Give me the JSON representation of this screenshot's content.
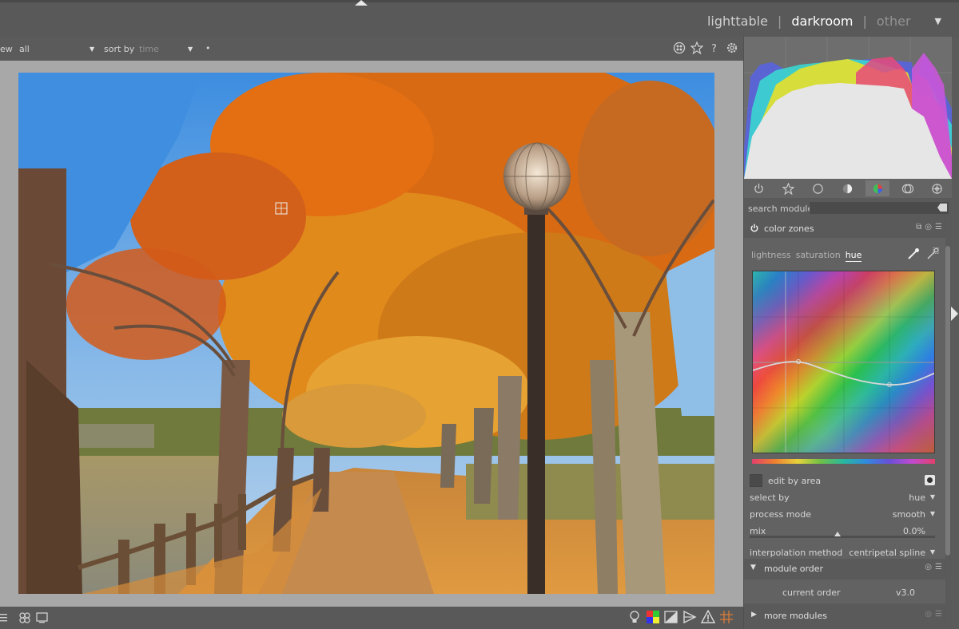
{
  "views": {
    "lighttable": "lighttable",
    "sep": "|",
    "darkroom": "darkroom",
    "other": "other"
  },
  "filterbar": {
    "view_label": "ew",
    "view_value": "all",
    "sort_label": "sort by",
    "sort_value": "time",
    "order_glyph": "•"
  },
  "filterbar_icons": [
    "grouping-icon",
    "star-icon",
    "help-icon",
    "gear-icon"
  ],
  "panel": {
    "search_label": "search module",
    "search_value": "",
    "tabs": [
      "power-icon",
      "favorites-icon",
      "base-icon",
      "tone-icon",
      "color-icon",
      "correct-icon",
      "effect-icon"
    ],
    "selected_tab": "color-icon"
  },
  "color_zones": {
    "title": "color zones",
    "tabs": [
      "lightness",
      "saturation",
      "hue"
    ],
    "active_tab": "hue",
    "edit_by_area_label": "edit by area",
    "select_by_label": "select by",
    "select_by_value": "hue",
    "process_mode_label": "process mode",
    "process_mode_value": "smooth",
    "mix_label": "mix",
    "mix_value": "0.0%",
    "mix_fraction": 0.0,
    "interpolation_label": "interpolation method",
    "interpolation_value": "centripetal spline"
  },
  "module_order": {
    "title": "module order",
    "current_label": "current order",
    "current_value": "v3.0"
  },
  "more_modules": {
    "title": "more modules"
  },
  "colors": {
    "background": "#5b5b5b",
    "panel": "#626262",
    "text": "#cfcfcf",
    "active_text": "#ffffff"
  }
}
